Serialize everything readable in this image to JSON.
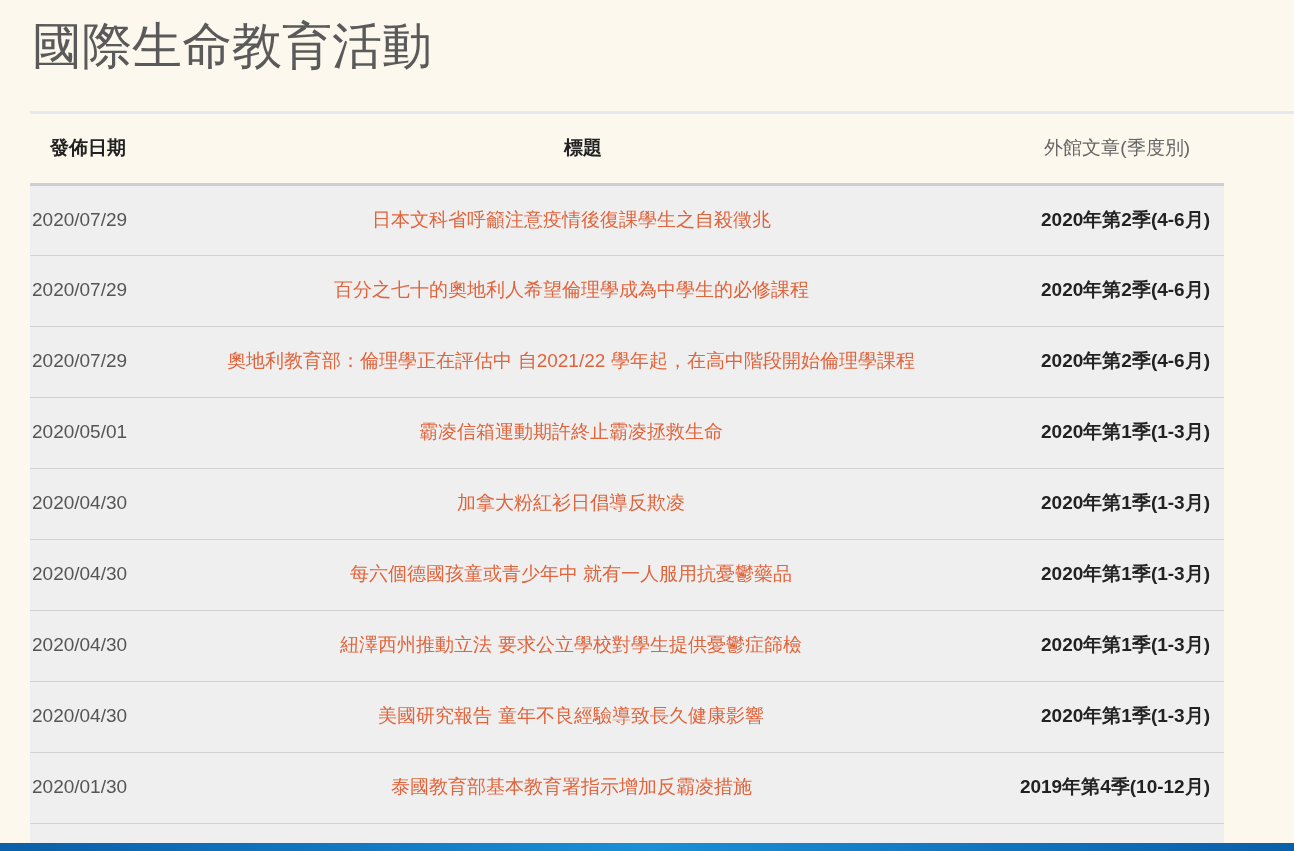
{
  "page_title": "國際生命教育活動",
  "table": {
    "columns": [
      "發佈日期",
      "標題",
      "外館文章(季度別)"
    ],
    "rows": [
      {
        "date": "2020/07/29",
        "title": "日本文科省呼籲注意疫情後復課學生之自殺徵兆",
        "quarter": "2020年第2季(4-6月)"
      },
      {
        "date": "2020/07/29",
        "title": "百分之七十的奧地利人希望倫理學成為中學生的必修課程",
        "quarter": "2020年第2季(4-6月)"
      },
      {
        "date": "2020/07/29",
        "title": "奧地利教育部：倫理學正在評估中 自2021/22 學年起，在高中階段開始倫理學課程",
        "quarter": "2020年第2季(4-6月)"
      },
      {
        "date": "2020/05/01",
        "title": "霸凌信箱運動期許終止霸凌拯救生命",
        "quarter": "2020年第1季(1-3月)"
      },
      {
        "date": "2020/04/30",
        "title": "加拿大粉紅衫日倡導反欺凌",
        "quarter": "2020年第1季(1-3月)"
      },
      {
        "date": "2020/04/30",
        "title": "每六個德國孩童或青少年中 就有一人服用抗憂鬱藥品",
        "quarter": "2020年第1季(1-3月)"
      },
      {
        "date": "2020/04/30",
        "title": "紐澤西州推動立法 要求公立學校對學生提供憂鬱症篩檢",
        "quarter": "2020年第1季(1-3月)"
      },
      {
        "date": "2020/04/30",
        "title": "美國研究報告 童年不良經驗導致長久健康影響",
        "quarter": "2020年第1季(1-3月)"
      },
      {
        "date": "2020/01/30",
        "title": "泰國教育部基本教育署指示增加反霸凌措施",
        "quarter": "2019年第4季(10-12月)"
      }
    ]
  }
}
